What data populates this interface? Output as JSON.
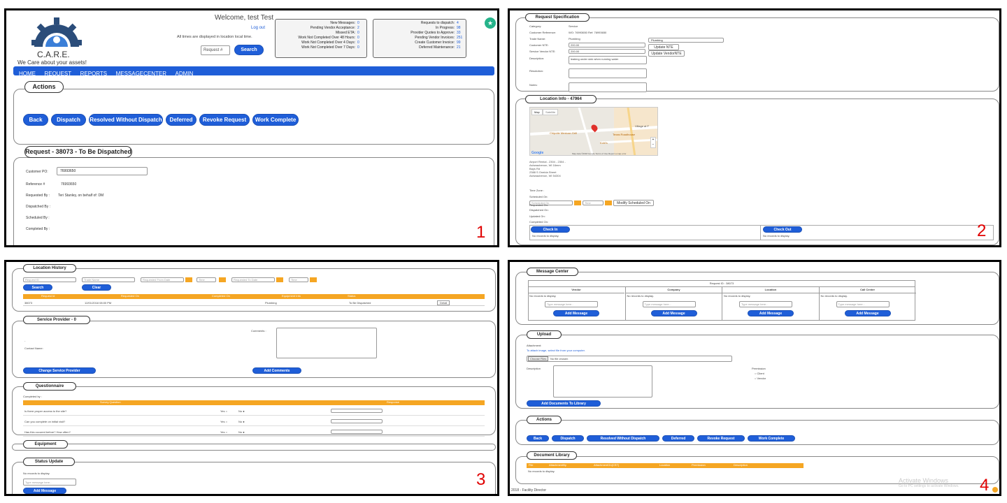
{
  "p1": {
    "logo_title": "C.A.R.E.",
    "logo_tagline": "We Care about your assets!",
    "welcome": "Welcome, test Test",
    "logout": "Log out",
    "times_note": "All times are displayed in location local time.",
    "request_placeholder": "Request #",
    "search": "Search",
    "stats_left": [
      {
        "label": "New Messages:",
        "value": "0"
      },
      {
        "label": "Pending Vendor Acceptance:",
        "value": "2"
      },
      {
        "label": "Missed ETA:",
        "value": "0"
      },
      {
        "label": "Work Not Completed Over 48 Hours:",
        "value": "0"
      },
      {
        "label": "Work Not Completed Over 4 Days:",
        "value": "0"
      },
      {
        "label": "Work Not Completed Over 7 Days:",
        "value": "0"
      }
    ],
    "stats_right": [
      {
        "label": "Requests to dispatch:",
        "value": "4"
      },
      {
        "label": "In Progress:",
        "value": "98"
      },
      {
        "label": "Provider Quotes to Approve:",
        "value": "33"
      },
      {
        "label": "Pending Vendor Invoices:",
        "value": "251"
      },
      {
        "label": "Create Customer Invoice:",
        "value": "99"
      },
      {
        "label": "Deferred Maintenance:",
        "value": "21"
      }
    ],
    "nav": [
      "HOME",
      "REQUEST",
      "REPORTS",
      "MESSAGECENTER",
      "ADMIN"
    ],
    "actions_title": "Actions",
    "actions": [
      "Back",
      "Dispatch",
      "Resolved Without Dispatch",
      "Deferred",
      "Revoke Request",
      "Work Complete"
    ],
    "request_title": "Request - 38073 - To Be Dispatched",
    "customer_po_label": "Customer PO:",
    "customer_po_value": "76993650",
    "reference_label": "Reference #",
    "reference_value": "76993650",
    "requested_by_label": "Requested By :",
    "requested_by_value": "Teri Stanley, on behalf of: DM",
    "dispatched_by_label": "Dispatched By :",
    "scheduled_by_label": "Scheduled By :",
    "completed_by_label": "Completed By :",
    "panel_number": "1"
  },
  "p2": {
    "spec_title": "Request Specification",
    "fields": [
      {
        "label": "Category:",
        "value": "Service"
      },
      {
        "label": "Customer Reference:",
        "value": "WO: 76993650 Ref: 76993650"
      },
      {
        "label": "Trade Name:",
        "value": "Plumbing"
      },
      {
        "label": "Customer NTE:",
        "value": "200.00"
      },
      {
        "label": "Service Vendor NTE:",
        "value": "200.00"
      },
      {
        "label": "Description:",
        "value": "leaking under sink when running water"
      },
      {
        "label": "Resolution:",
        "value": ""
      },
      {
        "label": "Notes:",
        "value": ""
      }
    ],
    "trade_select": "Plumbing",
    "update_nte": "Update NTE",
    "update_vendor_nte": "Update VendorNTE",
    "location_title": "Location Info - 47964",
    "map_tab1": "Map",
    "map_tab2": "Satellite",
    "map_label1": "Chipotle Mexican Grill",
    "map_label2": "Texas Roadhouse",
    "map_label3": "Village at F",
    "map_label4": "Kohl's",
    "map_google": "Google",
    "map_footer": "Map data ©2018 Google   Terms of Use   Report a map error",
    "address": [
      "Airport Rental - 2304 - 2304 -",
      "Ashwaubenon, WI 16mm",
      "Bays Rd",
      "2388 S Oneida Street",
      "Ashwaubenon, WI 54304"
    ],
    "time_zone": "Time Zone :",
    "scheduled_on": "Scheduled On:",
    "scheduled_placeholder": "Scheduled On",
    "time_placeholder": "Time",
    "modify_btn": "Modify Scheduled On",
    "requested_on": "Requested On:",
    "dispatched_on": "Dispatched On:",
    "updated_on": "Updated On:",
    "completed_on": "Completed On:",
    "check_in": "Check In",
    "check_out": "Check Out",
    "no_records": "No records to display.",
    "panel_number": "2"
  },
  "p3": {
    "history_title": "Location History",
    "ph_request_id": "Request ID",
    "ph_trade": "Trade Name",
    "ph_from": "Requested From Date",
    "ph_time": "Time",
    "ph_to": "Requested To Date",
    "search": "Search",
    "clear": "Clear",
    "history_cols": [
      "Request Id",
      "Requested On",
      "Completed On",
      "Equipment Info",
      "Status"
    ],
    "history_row": [
      "38073",
      "12/01/2018 08:00 PM",
      "",
      "Plumbing",
      "To Be Dispatched"
    ],
    "detail": "Detail",
    "sp_title": "Service Provider - 0",
    "comments": "Comments :",
    "contact_name": "Contact Name:",
    "change_sp": "Change Service Provider",
    "add_comments": "Add Comments",
    "q_title": "Questionnaire",
    "completed_by": "Completed by :",
    "q_cols": [
      "Survey Question",
      "",
      "Response"
    ],
    "questions": [
      "Is there proper access to the site?",
      "Can you complete on initial visit?",
      "Has this occured before? How often?"
    ],
    "yes": "Yes",
    "no": "No",
    "equip_title": "Equipment",
    "status_title": "Status Update",
    "no_records": "No records to display.",
    "type_msg": "Type message here...",
    "add_message": "Add Message",
    "panel_number": "3"
  },
  "p4": {
    "mc_title": "Message Center",
    "request_id": "Request ID : 38073",
    "mc_cols": [
      "Vendor",
      "Company",
      "Location",
      "Call Center"
    ],
    "no_records": "No records to display.",
    "type_msg": "Type message here...",
    "add_message": "Add Message",
    "upload_title": "Upload",
    "attachment": "Attachment:",
    "attach_hint": "To attach image, select file from your computer.",
    "choose_files": "Choose Files",
    "no_file": "No file chosen",
    "description": "Description",
    "permission": "Permission",
    "client": "Client",
    "vendor": "Vendor",
    "add_docs": "Add Documents To Library",
    "actions_title": "Actions",
    "actions": [
      "Back",
      "Dispatch",
      "Resolved Without Dispatch",
      "Deferred",
      "Revoke Request",
      "Work Complete"
    ],
    "doc_title": "Document Library",
    "doc_cols": [
      "File",
      "AttachmentBy",
      "AttachmentOn(CST)",
      "Location",
      "Permission",
      "Description"
    ],
    "footer": "2018 - Facility Director",
    "activate1": "Activate Windows",
    "activate2": "Go to PC settings to activate Windows.",
    "panel_number": "4"
  },
  "colors": {
    "accent": "#1f5ed8",
    "table_header": "#f5a623",
    "panel_number": "#e00000"
  }
}
